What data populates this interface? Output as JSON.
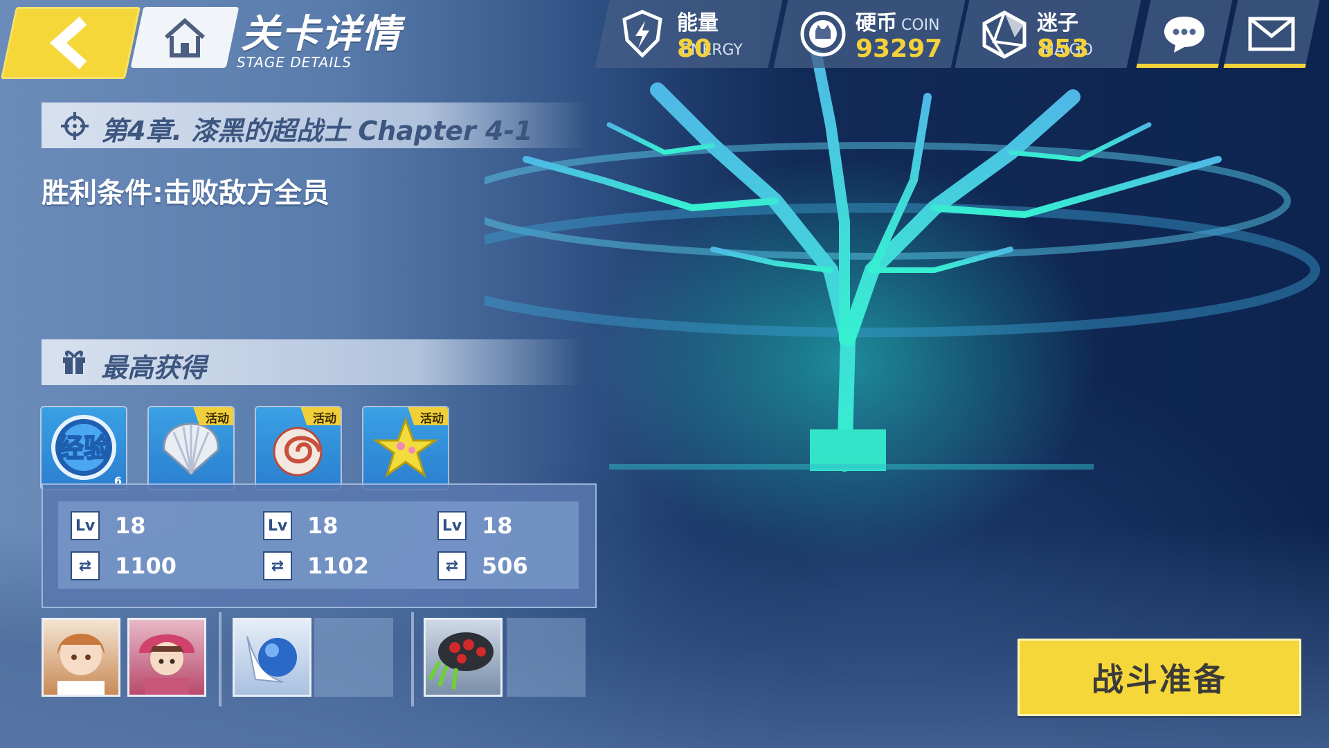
{
  "header": {
    "title_cn": "关卡详情",
    "title_en": "STAGE DETAILS"
  },
  "resources": {
    "energy": {
      "label": "能量",
      "label_en": "ENERGY",
      "value": "80",
      "icon": "energy-icon"
    },
    "coin": {
      "label": "硬币",
      "label_en": "COIN",
      "value": "93297",
      "icon": "coin-icon"
    },
    "maigo": {
      "label": "迷子",
      "label_en": "MAIGO",
      "value": "853",
      "icon": "maigo-icon"
    }
  },
  "stage": {
    "chapter": "第4章. 漆黑的超战士  Chapter 4-1",
    "victory_condition": "胜利条件:击败敌方全员"
  },
  "rewards": {
    "title": "最高获得",
    "items": [
      {
        "name": "exp-item",
        "tag": "",
        "count": "6",
        "icon_text": "经验"
      },
      {
        "name": "shell-item",
        "tag": "活动",
        "count": ""
      },
      {
        "name": "nautilus-item",
        "tag": "活动",
        "count": ""
      },
      {
        "name": "star-item",
        "tag": "活动",
        "count": ""
      }
    ]
  },
  "stats": [
    {
      "level": "18",
      "power": "1100"
    },
    {
      "level": "18",
      "power": "1102"
    },
    {
      "level": "18",
      "power": "506"
    }
  ],
  "stat_badge": "Lv",
  "battle_button": "战斗准备",
  "colors": {
    "accent": "#f5d73a",
    "panel": "#5a78af"
  }
}
